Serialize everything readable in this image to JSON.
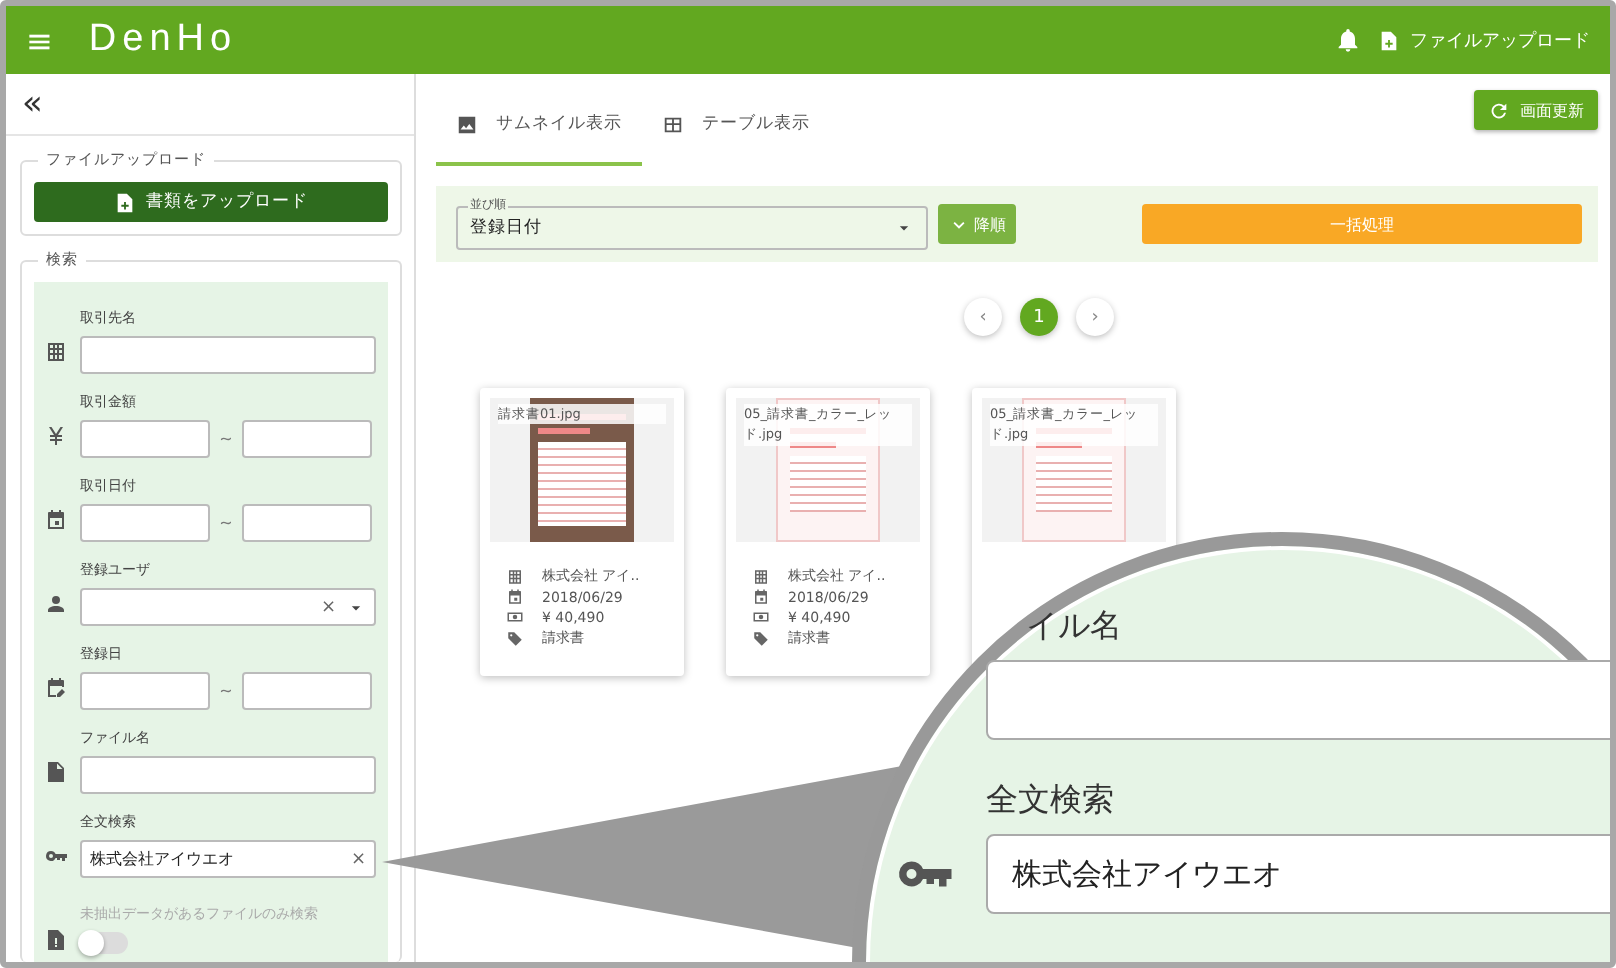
{
  "header": {
    "menu_glyph": "≡",
    "logo": "DenHo",
    "upload_link": "ファイルアップロード"
  },
  "sidebar": {
    "collapse_glyph": "«",
    "upload_section": {
      "legend": "ファイルアップロード",
      "button": "書類をアップロード"
    },
    "search_section": {
      "legend": "検索",
      "fields": [
        {
          "kind": "text",
          "label": "取引先名"
        },
        {
          "kind": "range",
          "label": "取引金額",
          "separator": "~"
        },
        {
          "kind": "range",
          "label": "取引日付",
          "separator": "~"
        },
        {
          "kind": "select",
          "label": "登録ユーザ",
          "clear_glyph": "×"
        },
        {
          "kind": "range",
          "label": "登録日",
          "separator": "~"
        },
        {
          "kind": "text",
          "label": "ファイル名"
        },
        {
          "kind": "text",
          "label": "全文検索",
          "value": "株式会社アイウエオ",
          "clear_glyph": "×"
        },
        {
          "kind": "toggle",
          "label": "未抽出データがあるファイルのみ検索",
          "on": false,
          "disabled": true
        }
      ]
    }
  },
  "tabs": [
    {
      "label": "サムネイル表示",
      "selected": true
    },
    {
      "label": "テーブル表示",
      "selected": false
    }
  ],
  "refresh_button": "画面更新",
  "toolbar": {
    "sort_legend": "並び順",
    "sort_value": "登録日付",
    "order_button": "降順",
    "bulk_button": "一括処理"
  },
  "pagination": {
    "prev": "‹",
    "pages": [
      {
        "label": "1",
        "selected": true
      }
    ],
    "next": "›"
  },
  "cards": [
    {
      "filename": "請求書01.jpg",
      "client": "株式会社 アイ..",
      "date": "2018/06/29",
      "amount": "¥ 40,490",
      "category": "請求書"
    },
    {
      "filename": "05_請求書_カラー_レッド.jpg",
      "client": "株式会社 アイ..",
      "date": "2018/06/29",
      "amount": "¥ 40,490",
      "category": "請求書"
    },
    {
      "filename": "05_請求書_カラー_レッド.jpg"
    }
  ],
  "magnifier": {
    "label_top": "イル名",
    "label": "全文検索",
    "value": "株式会社アイウエオ"
  }
}
